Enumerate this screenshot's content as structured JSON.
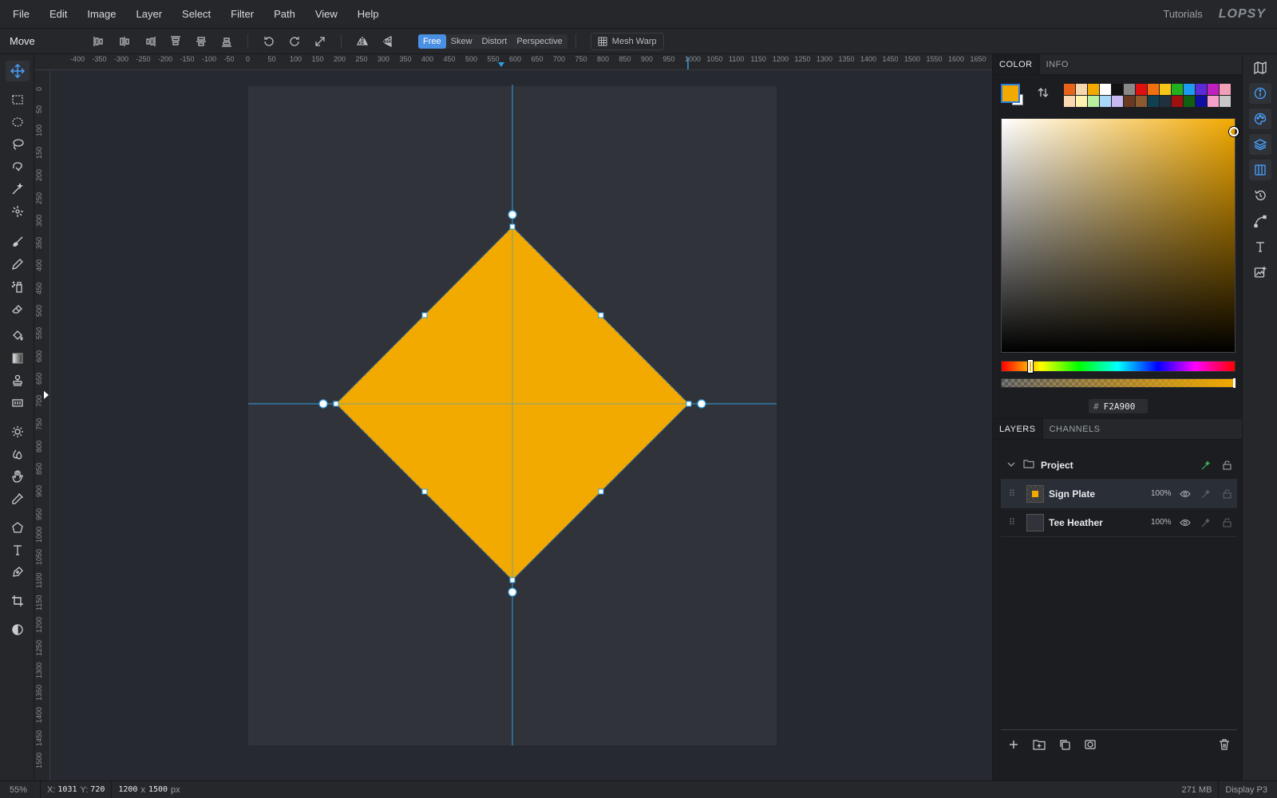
{
  "menubar": {
    "items": [
      "File",
      "Edit",
      "Image",
      "Layer",
      "Select",
      "Filter",
      "Path",
      "View",
      "Help"
    ],
    "tutorials": "Tutorials",
    "logo": "LOPSY"
  },
  "options": {
    "tool_name": "Move",
    "modes": [
      "Free",
      "Skew",
      "Distort",
      "Perspective"
    ],
    "active_mode": "Free",
    "mesh_warp": "Mesh Warp"
  },
  "rulers": {
    "h_ticks": [
      "-400",
      "-350",
      "-300",
      "-250",
      "-200",
      "-150",
      "-100",
      "-50",
      "0",
      "50",
      "100",
      "150",
      "200",
      "250",
      "300",
      "350",
      "400",
      "450",
      "500",
      "550",
      "600",
      "650",
      "700",
      "750",
      "800",
      "850",
      "900",
      "950",
      "1000",
      "1050",
      "1100",
      "1150",
      "1200",
      "1250",
      "1300",
      "1350",
      "1400",
      "1450",
      "1500",
      "1550",
      "1600",
      "1650"
    ],
    "v_ticks": [
      "0",
      "50",
      "100",
      "150",
      "200",
      "250",
      "300",
      "350",
      "400",
      "450",
      "500",
      "550",
      "600",
      "650",
      "700",
      "750",
      "800",
      "850",
      "900",
      "950",
      "1000",
      "1050",
      "1100",
      "1150",
      "1200",
      "1250",
      "1300",
      "1350",
      "1400",
      "1450",
      "1500"
    ]
  },
  "canvas": {
    "shape_color": "#F2A900",
    "guide_color": "#2fa0e0"
  },
  "color_panel": {
    "tabs": [
      "COLOR",
      "INFO"
    ],
    "foreground": "#F2A900",
    "background": "#FFFFFF",
    "hex_value": "F2A900",
    "hash": "#",
    "palette": [
      "#e8631a",
      "#f5d7b0",
      "#f2a900",
      "#ffffff",
      "#111111",
      "#888888",
      "#e01010",
      "#f07010",
      "#f5c518",
      "#20b020",
      "#1e9bf0",
      "#5b2bd8",
      "#c020c0",
      "#f2a0b8",
      "#fbd9b0",
      "#fff3b0",
      "#b8f0a0",
      "#a8d8f8",
      "#c8b8f0",
      "#6a3a20",
      "#8b5a30",
      "#104050",
      "#203040",
      "#a01010",
      "#106010",
      "#1010a0",
      "#f5a0c8",
      "#c8c8c8"
    ]
  },
  "layers_panel": {
    "tabs": [
      "LAYERS",
      "CHANNELS"
    ],
    "group": "Project",
    "layers": [
      {
        "name": "Sign Plate",
        "opacity": "100%"
      },
      {
        "name": "Tee Heather",
        "opacity": "100%"
      }
    ]
  },
  "status": {
    "zoom": "55%",
    "x_label": "X:",
    "x": "1031",
    "y_label": "Y:",
    "y": "720",
    "width": "1200",
    "x_sep": "x",
    "height": "1500",
    "unit": "px",
    "memory": "271 MB",
    "display": "Display P3"
  }
}
